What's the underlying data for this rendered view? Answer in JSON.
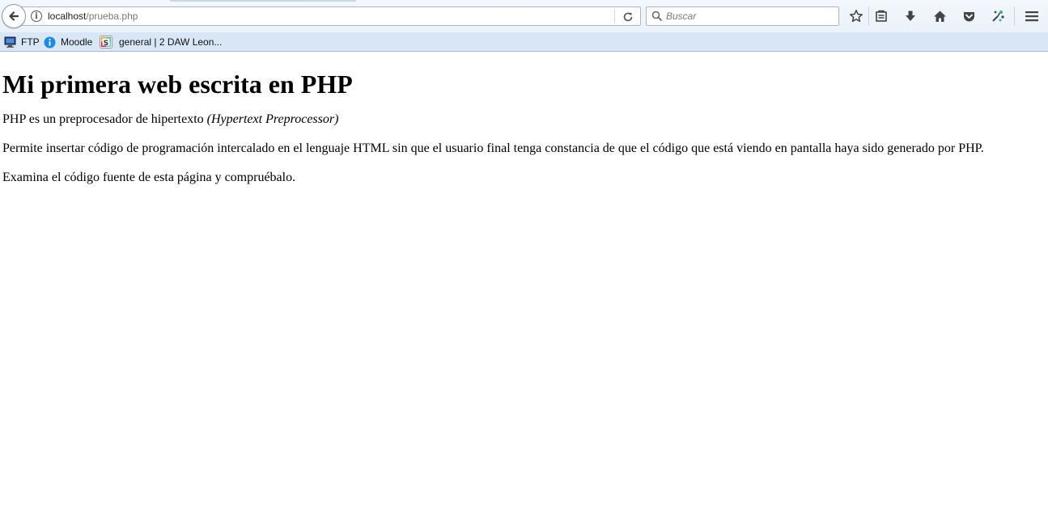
{
  "browser": {
    "url_host": "localhost",
    "url_path": "/prueba.php",
    "search_placeholder": "Buscar"
  },
  "toolbar_icons": [
    "back-arrow-icon",
    "info-icon",
    "reload-icon",
    "search-icon",
    "bookmark-star-icon",
    "reading-list-icon",
    "download-icon",
    "home-icon",
    "pocket-icon",
    "extension-icon",
    "menu-icon"
  ],
  "bookmarks": [
    {
      "label": "FTP",
      "icon": "monitor-icon"
    },
    {
      "label": "Moodle",
      "icon": "info-circle-icon"
    },
    {
      "label": "general | 2 DAW Leon...",
      "icon": "slack-icon"
    }
  ],
  "page": {
    "heading": "Mi primera web escrita en PHP",
    "p1_text": "PHP es un preprocesador de hipertexto ",
    "p1_em": "(Hypertext Preprocessor)",
    "p2": "Permite insertar código de programación intercalado en el lenguaje HTML sin que el usuario final tenga constancia de que el código que está viendo en pantalla haya sido generado por PHP.",
    "p3": "Examina el código fuente de esta página y compruébalo."
  },
  "colors": {
    "toolbar_bg": "#eaf1f9",
    "bookmarks_bg": "#d9e6f5",
    "icon": "#444444",
    "moodle_blue": "#1e88e5"
  }
}
